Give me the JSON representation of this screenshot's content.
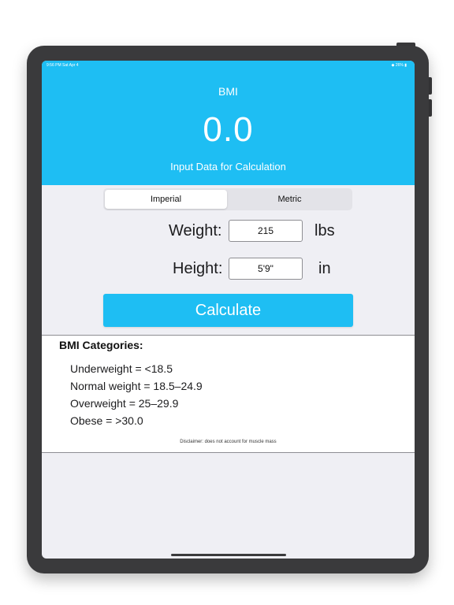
{
  "status_bar": {
    "time": "9:56 PM  Sat Apr 4",
    "battery": "◆ 26% ▮"
  },
  "header": {
    "title": "BMI",
    "value": "0.0",
    "subtitle": "Input Data for Calculation"
  },
  "units_toggle": {
    "options": [
      "Imperial",
      "Metric"
    ],
    "selected": "Imperial"
  },
  "weight": {
    "label": "Weight:",
    "value": "215",
    "unit": "lbs"
  },
  "height": {
    "label": "Height:",
    "value": "5'9\"",
    "unit": "in"
  },
  "calculate_label": "Calculate",
  "categories": {
    "title": "BMI Categories:",
    "items": [
      "Underweight = <18.5",
      "Normal weight = 18.5–24.9",
      "Overweight = 25–29.9",
      "Obese = >30.0"
    ],
    "disclaimer": "Disclaimer: does not account for muscle mass"
  },
  "colors": {
    "accent": "#1ebef3",
    "background": "#efeff4",
    "device_frame": "#3a3a3c"
  }
}
